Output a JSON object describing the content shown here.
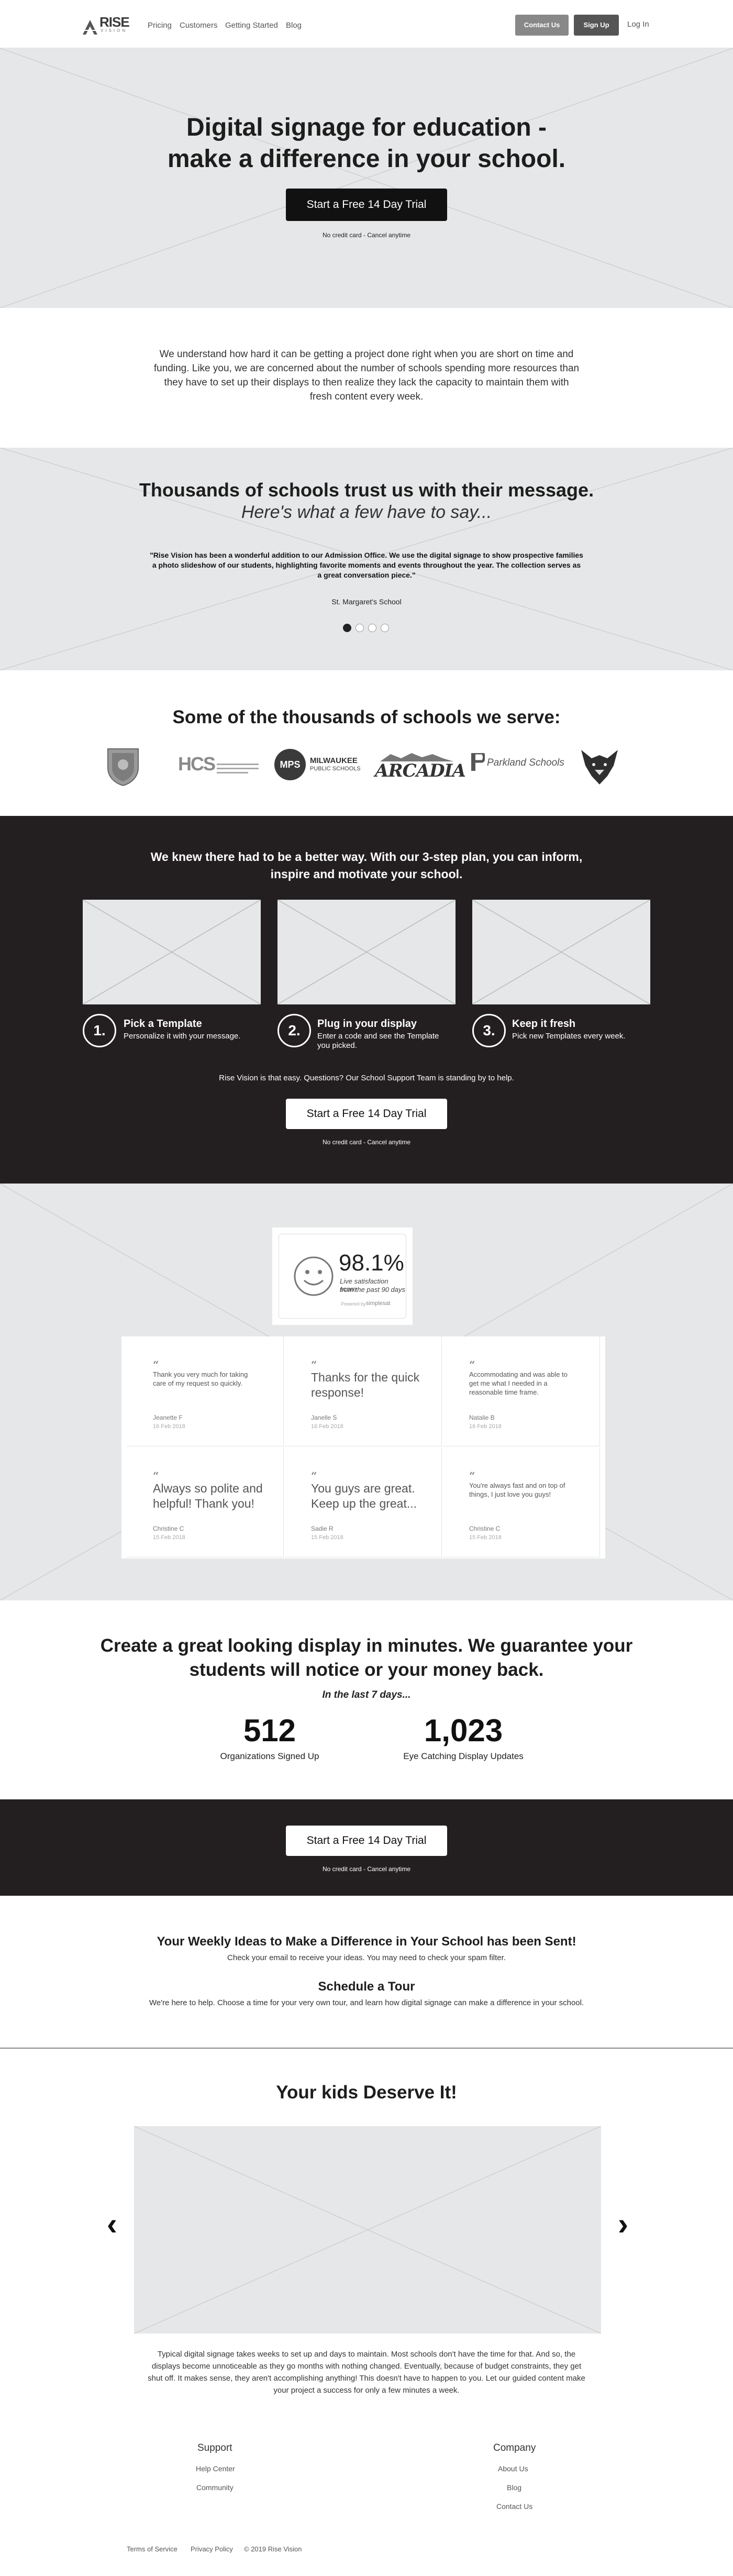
{
  "nav": {
    "logo_word": "RISE",
    "logo_sub": "VISION",
    "links": [
      "Pricing",
      "Customers",
      "Getting Started",
      "Blog"
    ],
    "contact_label": "Contact Us",
    "signup_label": "Sign Up",
    "login_label": "Log In"
  },
  "hero": {
    "title_line1": "Digital signage for education -",
    "title_line2": "make a difference in your school.",
    "cta_label": "Start a Free 14 Day Trial",
    "cta_note": "No credit card - Cancel anytime"
  },
  "intro": {
    "line1": "We understand how hard it can be getting a project done right when you are short on time and",
    "line2": "funding. Like you, we are concerned about the number of schools spending more resources than",
    "line3": "they have to set up their displays to then realize they lack the capacity to maintain them with",
    "line4": "fresh content every week."
  },
  "trust": {
    "title": "Thousands of schools trust us with their message.",
    "subtitle": "Here's what a few have to say...",
    "quote_line1": "\"Rise Vision has been a wonderful addition to our Admission Office. We use the digital signage to show prospective families",
    "quote_line2": "a photo slideshow of our students, highlighting favorite moments and events throughout the year. The collection serves as",
    "quote_line3": "a great conversation piece.\"",
    "author": "St. Margaret's School",
    "dots_total": 4,
    "dots_active": 1
  },
  "schools": {
    "title": "Some of the thousands of schools we serve:",
    "logos": [
      "crest-logo",
      "hcs-logo",
      "mps-logo",
      "arcadia-logo",
      "parkland-logo",
      "wolf-logo"
    ],
    "logo_texts": {
      "hcs": "HCS",
      "mps": "MPS",
      "milwaukee": "MILWAUKEE",
      "public_schools": "PUBLIC SCHOOLS",
      "arcadia": "ARCADIA",
      "parkland": "Parkland Schools"
    }
  },
  "steps": {
    "title_line1": "We knew there had to be a better way. With our 3-step plan, you can inform,",
    "title_line2": "inspire and motivate your school.",
    "items": [
      {
        "num": "1.",
        "title": "Pick a Template",
        "desc1": "Personalize it with your message.",
        "desc2": ""
      },
      {
        "num": "2.",
        "title": "Plug in your display",
        "desc1": "Enter a code and see the Template",
        "desc2": "you picked."
      },
      {
        "num": "3.",
        "title": "Keep it fresh",
        "desc1": "Pick new Templates every week.",
        "desc2": ""
      }
    ],
    "support_text": "Rise Vision is that easy. Questions? Our School Support Team is standing by to help.",
    "cta_label": "Start a Free 14 Day Trial",
    "cta_note": "No credit card - Cancel anytime"
  },
  "satisfaction": {
    "score": "98.1%",
    "line1": "Live satisfaction score",
    "line2": "from the past 90 days",
    "powered": "Powered by",
    "brand": "simplesat",
    "cards": [
      {
        "text": "Thank you very much for taking care of my request so quickly.",
        "who": "Jeanette F",
        "when": "16 Feb 2018",
        "big": false
      },
      {
        "text": "Thanks for the quick response!",
        "who": "Janelle S",
        "when": "16 Feb 2018",
        "big": true
      },
      {
        "text": "Accommodating and was able to get me what I needed in a reasonable time frame.",
        "who": "Natalie B",
        "when": "16 Feb 2018",
        "big": false
      },
      {
        "text": "Always so polite and helpful! Thank you!",
        "who": "Christine C",
        "when": "15 Feb 2018",
        "big": true
      },
      {
        "text": "You guys are great. Keep up the great...",
        "who": "Sadie R",
        "when": "15 Feb 2018",
        "big": true
      },
      {
        "text": "You're always fast and on top of things, I just love you guys!",
        "who": "Christine C",
        "when": "15 Feb 2018",
        "big": false
      }
    ]
  },
  "guarantee": {
    "title_line1": "Create a great looking display in minutes. We guarantee your",
    "title_line2": "students will notice or your money back.",
    "subtitle": "In the last 7 days...",
    "stats": [
      {
        "value": "512",
        "label": "Organizations Signed Up"
      },
      {
        "value": "1,023",
        "label": "Eye Catching Display Updates"
      }
    ]
  },
  "cta_band": {
    "cta_label": "Start a Free 14 Day Trial",
    "cta_note": "No credit card - Cancel anytime"
  },
  "sent": {
    "title": "Your Weekly Ideas to Make a Difference in Your School has been Sent!",
    "text": "Check your email to receive your ideas. You may need to check your spam filter.",
    "tour_title": "Schedule a Tour",
    "tour_text": "We're here to help. Choose a time for your very own tour, and learn how digital signage can make a difference in your school."
  },
  "kids": {
    "title": "Your kids Deserve It!",
    "prev_glyph": "‹",
    "next_glyph": "›",
    "para_line1": "Typical digital signage takes weeks to set up and days to maintain. Most schools don't have the time for that. And so, the",
    "para_line2": "displays become unnoticeable as they go months with nothing changed. Eventually, because of budget constraints, they get",
    "para_line3": "shut off. It makes sense, they aren't accomplishing anything! This doesn't have to happen to you. Let our guided content make",
    "para_line4": "your project a success for only a few minutes a week."
  },
  "footer": {
    "support_head": "Support",
    "support_links": [
      "Help Center",
      "Community"
    ],
    "company_head": "Company",
    "company_links": [
      "About Us",
      "Blog",
      "Contact Us"
    ],
    "bottom_links": [
      "Terms of Service",
      "Privacy Policy",
      "© 2019 Rise Vision"
    ]
  },
  "colors": {
    "dark_band": "#231f20",
    "gray_band": "#e6e7e8",
    "button_dark": "#555555",
    "button_gray": "#888888"
  }
}
